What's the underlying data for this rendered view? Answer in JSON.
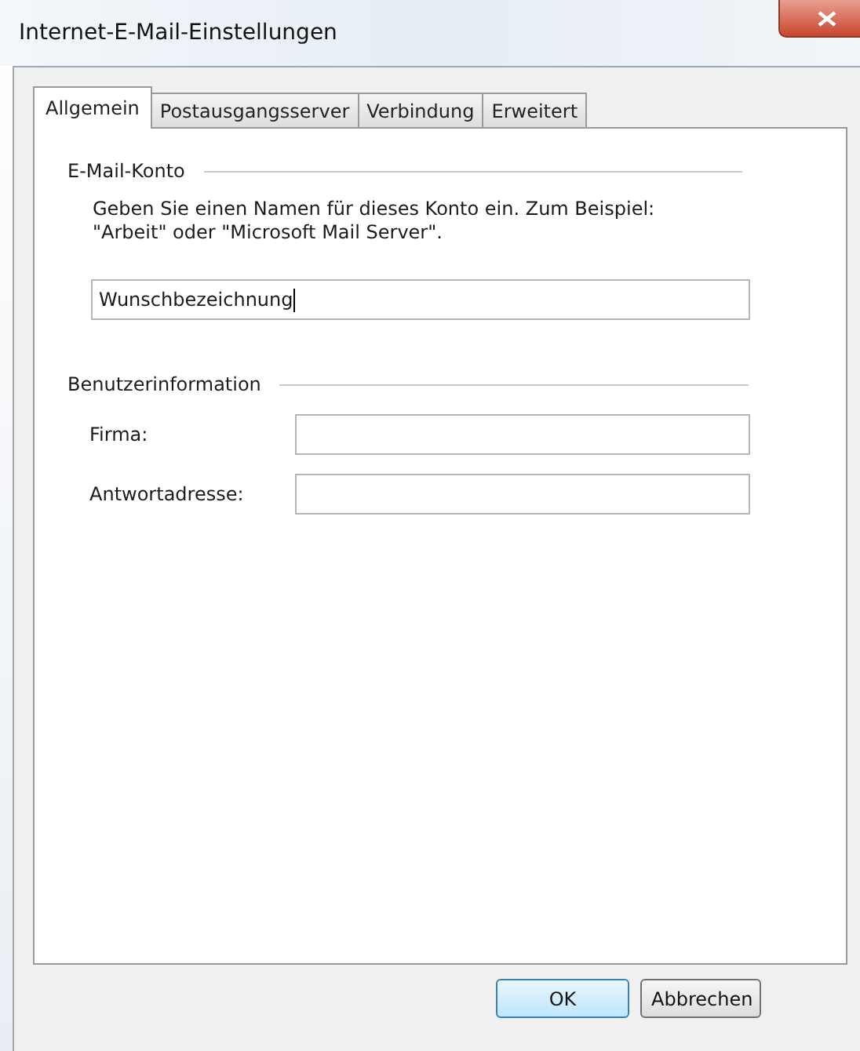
{
  "window": {
    "title": "Internet-E-Mail-Einstellungen"
  },
  "tabs": [
    {
      "label": "Allgemein",
      "selected": true
    },
    {
      "label": "Postausgangsserver",
      "selected": false
    },
    {
      "label": "Verbindung",
      "selected": false
    },
    {
      "label": "Erweitert",
      "selected": false
    }
  ],
  "account": {
    "heading": "E-Mail-Konto",
    "description": "Geben Sie einen Namen für dieses Konto ein. Zum Beispiel:\n\"Arbeit\" oder \"Microsoft Mail Server\".",
    "value": "Wunschbezeichnung"
  },
  "user_info": {
    "heading": "Benutzerinformation",
    "fields": [
      {
        "label": "Firma:"
      },
      {
        "label": "Antwortadresse:"
      }
    ]
  },
  "buttons": [
    {
      "label": "OK",
      "default": true
    },
    {
      "label": "Abbrechen",
      "default": false
    }
  ]
}
